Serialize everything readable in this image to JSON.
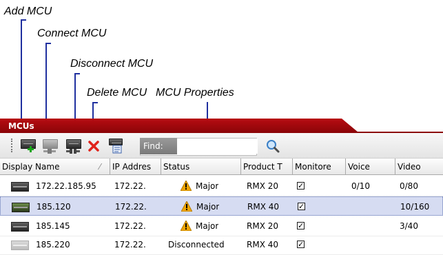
{
  "callouts": {
    "add": "Add MCU",
    "connect": "Connect MCU",
    "disconnect": "Disconnect MCU",
    "delete": "Delete MCU",
    "properties": "MCU Properties"
  },
  "panel": {
    "tab_title": "MCUs"
  },
  "toolbar": {
    "find_label": "Find:",
    "find_value": "",
    "icons": [
      "add-mcu-icon",
      "connect-mcu-icon",
      "disconnect-mcu-icon",
      "delete-mcu-icon",
      "mcu-properties-icon",
      "search-icon"
    ]
  },
  "columns": [
    "Display Name",
    "IP Addres",
    "Status",
    "Product T",
    "Monitore",
    "Voice",
    "Video"
  ],
  "sort_indicator": "⁄",
  "rows": [
    {
      "name": "172.22.185.95",
      "ip": "172.22.",
      "status": "Major",
      "product": "RMX 20",
      "monitored": "✓",
      "voice": "0/10",
      "video": "0/80",
      "icon": "mcu-icon"
    },
    {
      "name": "185.120",
      "ip": "172.22.",
      "status": "Major",
      "product": "RMX 40",
      "monitored": "✓",
      "voice": "",
      "video": "10/160",
      "icon": "mcu-icon"
    },
    {
      "name": "185.145",
      "ip": "172.22.",
      "status": "Major",
      "product": "RMX 20",
      "monitored": "✓",
      "voice": "",
      "video": "3/40",
      "icon": "mcu-icon"
    },
    {
      "name": "185.220",
      "ip": "172.22.",
      "status": "Disconnected",
      "product": "RMX 40",
      "monitored": "✓",
      "voice": "",
      "video": "",
      "icon": "mcu-icon"
    }
  ],
  "colors": {
    "tab_red": "#b70c12",
    "callout_line": "#1f2f9f",
    "selected_row": "#d6dcf2",
    "warning": "#f0a500"
  }
}
